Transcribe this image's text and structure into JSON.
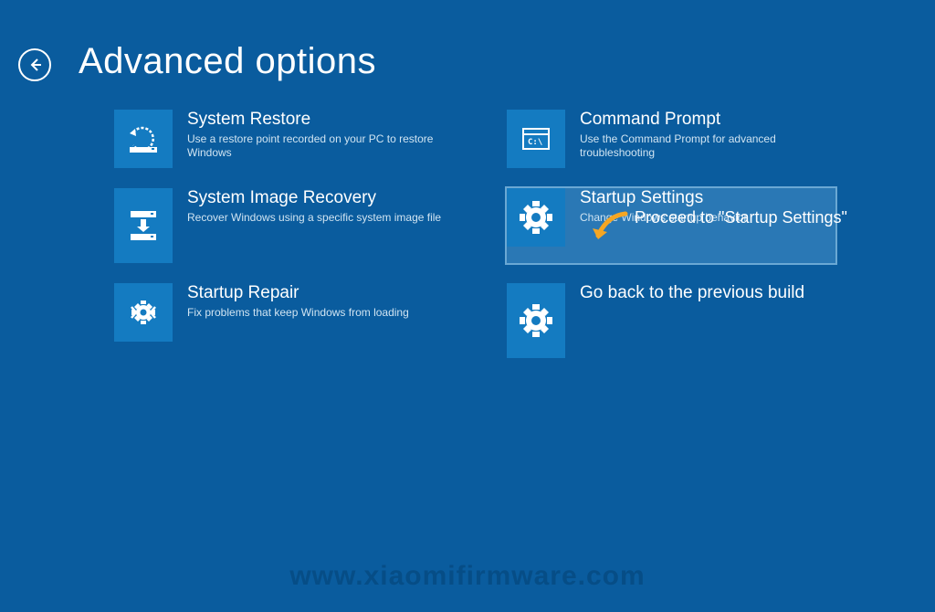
{
  "header": {
    "title": "Advanced options"
  },
  "options": {
    "systemRestore": {
      "title": "System Restore",
      "desc": "Use a restore point recorded on your PC to restore Windows"
    },
    "commandPrompt": {
      "title": "Command Prompt",
      "desc": "Use the Command Prompt for advanced troubleshooting"
    },
    "systemImageRecovery": {
      "title": "System Image Recovery",
      "desc": "Recover Windows using a specific system image file"
    },
    "startupSettings": {
      "title": "Startup Settings",
      "desc": "Change Windows startup behavior"
    },
    "startupRepair": {
      "title": "Startup Repair",
      "desc": "Fix problems that keep Windows from loading"
    },
    "goBack": {
      "title": "Go back to the previous build",
      "desc": ""
    }
  },
  "annotation": {
    "text": "Proceed to \"Startup Settings\""
  },
  "watermark": "www.xiaomifirmware.com"
}
